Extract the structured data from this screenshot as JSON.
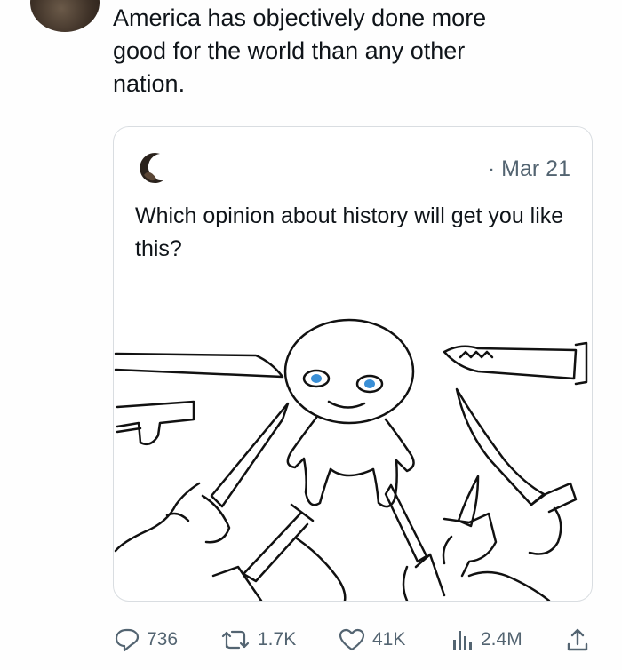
{
  "tweet": {
    "text": "America has objectively done more\ngood for the world than any other\nnation."
  },
  "quote": {
    "date": "· Mar 21",
    "text": "Which opinion about history will get you like this?"
  },
  "actions": {
    "replies": "736",
    "retweets": "1.7K",
    "likes": "41K",
    "views": "2.4M"
  },
  "icons": {
    "reply": "reply-icon",
    "retweet": "retweet-icon",
    "like": "heart-icon",
    "views": "views-icon",
    "share": "share-icon"
  },
  "colors": {
    "text": "#0f1419",
    "secondary": "#536471",
    "border": "#d9dde1",
    "eyes": "#3a8fd6"
  }
}
